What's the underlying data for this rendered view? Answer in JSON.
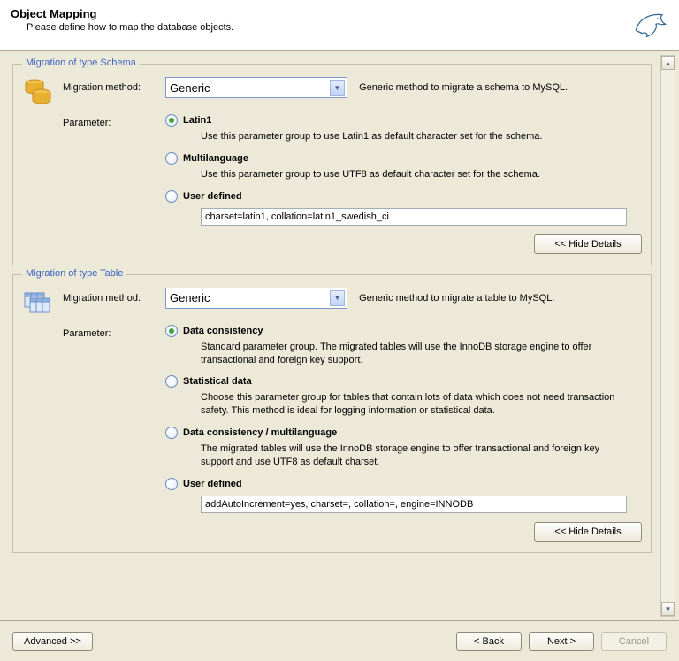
{
  "header": {
    "title": "Object Mapping",
    "subtitle": "Please define how to map the database objects."
  },
  "schema": {
    "group_title": "Migration of type Schema",
    "method_label": "Migration method:",
    "method_value": "Generic",
    "method_desc": "Generic method to migrate a schema to MySQL.",
    "param_label": "Parameter:",
    "opts": {
      "latin1": {
        "label": "Latin1",
        "desc": "Use this parameter group to use Latin1 as default character set for the schema."
      },
      "multilang": {
        "label": "Multilanguage",
        "desc": "Use this parameter group to use UTF8 as default character set for the schema."
      },
      "user": {
        "label": "User defined",
        "value": "charset=latin1, collation=latin1_swedish_ci"
      }
    },
    "hide_details": "<< Hide Details"
  },
  "table": {
    "group_title": "Migration of type Table",
    "method_label": "Migration method:",
    "method_value": "Generic",
    "method_desc": "Generic method to migrate a table to MySQL.",
    "param_label": "Parameter:",
    "opts": {
      "dc": {
        "label": "Data consistency",
        "desc": "Standard parameter group. The migrated tables will use the InnoDB storage engine to offer transactional and foreign key support."
      },
      "stat": {
        "label": "Statistical data",
        "desc": "Choose this parameter group for tables that contain lots of data which does not need transaction safety. This method is ideal for logging information or statistical data."
      },
      "dcml": {
        "label": "Data consistency / multilanguage",
        "desc": "The migrated tables will use the InnoDB storage engine to offer transactional and foreign key support and use UTF8 as default charset."
      },
      "user": {
        "label": "User defined",
        "value": "addAutoIncrement=yes, charset=, collation=, engine=INNODB"
      }
    },
    "hide_details": "<< Hide Details"
  },
  "footer": {
    "advanced": "Advanced >>",
    "back": "< Back",
    "next": "Next >",
    "cancel": "Cancel"
  }
}
